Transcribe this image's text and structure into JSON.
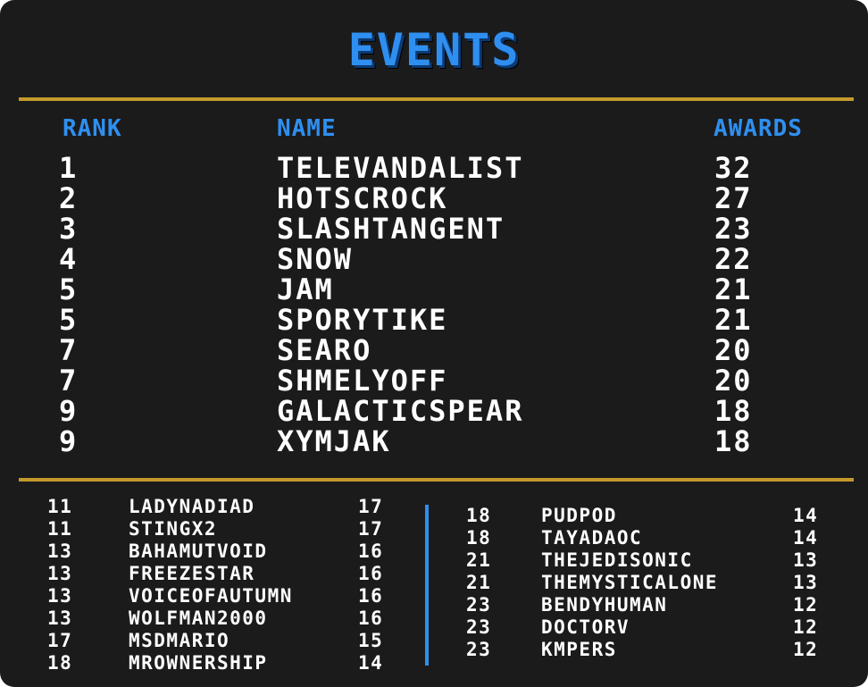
{
  "title": "EVENTS",
  "headers": {
    "rank": "RANK",
    "name": "NAME",
    "awards": "AWARDS"
  },
  "top": [
    {
      "rank": "1",
      "name": "TELEVANDALIST",
      "awards": "32"
    },
    {
      "rank": "2",
      "name": "HOTSCROCK",
      "awards": "27"
    },
    {
      "rank": "3",
      "name": "SLASHTANGENT",
      "awards": "23"
    },
    {
      "rank": "4",
      "name": "SNOW",
      "awards": "22"
    },
    {
      "rank": "5",
      "name": "JAM",
      "awards": "21"
    },
    {
      "rank": "5",
      "name": "SPORYTIKE",
      "awards": "21"
    },
    {
      "rank": "7",
      "name": "SEARO",
      "awards": "20"
    },
    {
      "rank": "7",
      "name": "SHMELYOFF",
      "awards": "20"
    },
    {
      "rank": "9",
      "name": "GALACTICSPEAR",
      "awards": "18"
    },
    {
      "rank": "9",
      "name": "XYMJAK",
      "awards": "18"
    }
  ],
  "bottom_left": [
    {
      "rank": "11",
      "name": "LADYNADIAD",
      "awards": "17"
    },
    {
      "rank": "11",
      "name": "STINGX2",
      "awards": "17"
    },
    {
      "rank": "13",
      "name": "BAHAMUTVOID",
      "awards": "16"
    },
    {
      "rank": "13",
      "name": "FREEZESTAR",
      "awards": "16"
    },
    {
      "rank": "13",
      "name": "VOICEOFAUTUMN",
      "awards": "16"
    },
    {
      "rank": "13",
      "name": "WOLFMAN2000",
      "awards": "16"
    },
    {
      "rank": "17",
      "name": "MSDMARIO",
      "awards": "15"
    },
    {
      "rank": "18",
      "name": "MROWNERSHIP",
      "awards": "14"
    }
  ],
  "bottom_right": [
    {
      "rank": "18",
      "name": "PUDPOD",
      "awards": "14"
    },
    {
      "rank": "18",
      "name": "TAYADAOC",
      "awards": "14"
    },
    {
      "rank": "21",
      "name": "THEJEDISONIC",
      "awards": "13"
    },
    {
      "rank": "21",
      "name": "THEMYSTICALONE",
      "awards": "13"
    },
    {
      "rank": "23",
      "name": "BENDYHUMAN",
      "awards": "12"
    },
    {
      "rank": "23",
      "name": "DOCTORV",
      "awards": "12"
    },
    {
      "rank": "23",
      "name": "KMPERS",
      "awards": "12"
    }
  ],
  "colors": {
    "background": "#1b1b1b",
    "accent_blue": "#2f8ff0",
    "rule_gold": "#c49a2c",
    "text": "#ffffff"
  }
}
